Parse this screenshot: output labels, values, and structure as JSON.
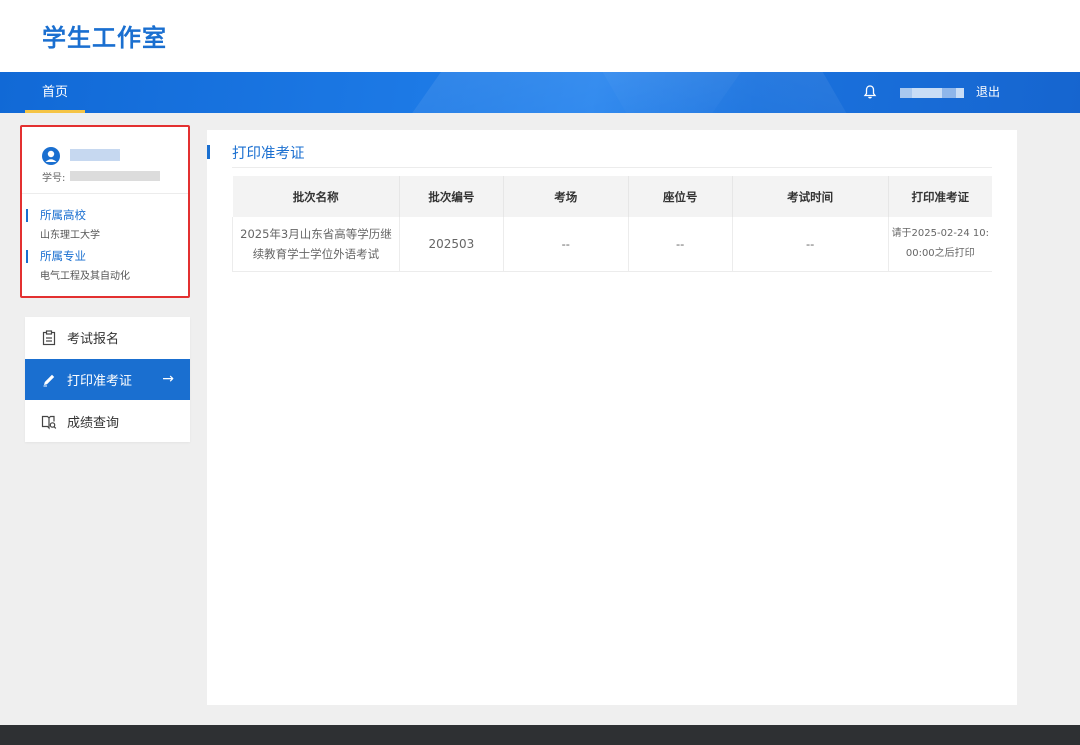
{
  "header": {
    "logo_text": "学生工作室"
  },
  "nav": {
    "home_label": "首页",
    "logout_label": "退出"
  },
  "profile": {
    "student_id_label": "学号:",
    "school_label": "所属高校",
    "school_value": "山东理工大学",
    "major_label": "所属专业",
    "major_value": "电气工程及其自动化"
  },
  "menu": {
    "items": [
      {
        "label": "考试报名",
        "icon": "clipboard-icon",
        "active": false
      },
      {
        "label": "打印准考证",
        "icon": "pencil-icon",
        "active": true
      },
      {
        "label": "成绩查询",
        "icon": "book-search-icon",
        "active": false
      }
    ],
    "active_arrow": "→"
  },
  "main": {
    "title": "打印准考证",
    "table": {
      "headers": [
        "批次名称",
        "批次编号",
        "考场",
        "座位号",
        "考试时间",
        "打印准考证"
      ],
      "rows": [
        {
          "name_line1": "2025年3月山东省高等学历继",
          "name_line2": "续教育学士学位外语考试",
          "code": "202503",
          "room": "--",
          "seat": "--",
          "time": "--",
          "print_line1": "请于2025-02-24 10:",
          "print_line2": "00:00之后打印"
        }
      ]
    }
  },
  "colors": {
    "accent": "#1a6fd0",
    "highlight_border": "#e33030",
    "nav_underline": "#f5c445",
    "footer": "#2e3033"
  }
}
